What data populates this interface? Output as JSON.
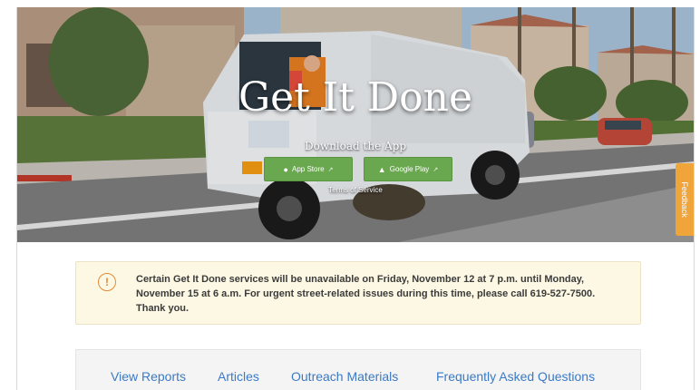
{
  "hero": {
    "title": "Get It Done",
    "download_label": "Download the App",
    "app_store": {
      "label": "App Store",
      "icon": "apple-icon"
    },
    "google_play": {
      "label": "Google Play",
      "icon": "android-icon"
    },
    "terms_label": "Terms of Service"
  },
  "feedback_label": "Feedback",
  "notice": {
    "icon": "alert-circle-icon",
    "icon_glyph": "!",
    "text": "Certain Get It Done services will be unavailable on Friday, November 12 at 7 p.m. until Monday, November 15 at 6 a.m. For urgent street-related issues during this time, please call 619-527-7500. Thank you."
  },
  "nav": {
    "items": [
      {
        "label": "View Reports"
      },
      {
        "label": "Articles"
      },
      {
        "label": "Outreach Materials"
      },
      {
        "label": "Frequently Asked Questions"
      }
    ]
  },
  "colors": {
    "store_button": "#6aa84f",
    "feedback_tab": "#f0a53a",
    "notice_background": "#fdf8e4",
    "notice_icon": "#e08a3a",
    "nav_link": "#3a7ac6"
  }
}
